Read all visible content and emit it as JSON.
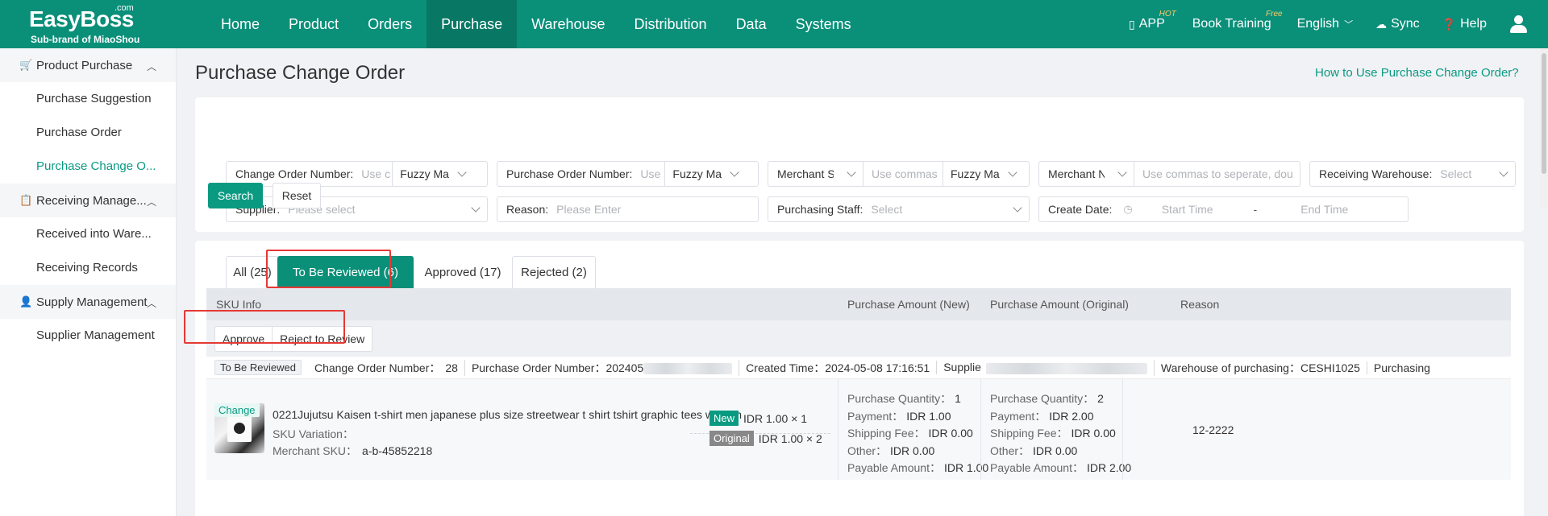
{
  "brand": {
    "name": "EasyBoss",
    "suffix": ".com",
    "sub": "Sub-brand of MiaoShou"
  },
  "nav": [
    "Home",
    "Product",
    "Orders",
    "Purchase",
    "Warehouse",
    "Distribution",
    "Data",
    "Systems"
  ],
  "nav_active": "Purchase",
  "top_right": {
    "app": "APP",
    "app_badge": "HOT",
    "training": "Book Training",
    "training_badge": "Free",
    "language": "English",
    "sync": "Sync",
    "help": "Help"
  },
  "sidebar": {
    "groups": [
      {
        "label": "Product Purchase",
        "items": [
          "Purchase Suggestion",
          "Purchase Order",
          "Purchase Change O..."
        ]
      },
      {
        "label": "Receiving Manage...",
        "items": [
          "Received into Ware...",
          "Receiving Records"
        ]
      },
      {
        "label": "Supply Management",
        "items": [
          "Supplier Management"
        ]
      }
    ]
  },
  "page": {
    "title": "Purchase Change Order",
    "help_link": "How to Use Purchase Change Order?"
  },
  "filters": {
    "change_order_number": {
      "label": "Change Order Number:",
      "placeholder": "Use c",
      "mode": "Fuzzy Ma"
    },
    "purchase_order_number": {
      "label": "Purchase Order Number:",
      "placeholder": "Use",
      "mode": "Fuzzy Ma"
    },
    "merchant_s": {
      "label": "Merchant S",
      "placeholder": "Use commas",
      "mode": "Fuzzy Ma"
    },
    "merchant_n": {
      "label": "Merchant N",
      "placeholder": "Use commas to seperate, dou"
    },
    "receiving_warehouse": {
      "label": "Receiving Warehouse:",
      "placeholder": "Select"
    },
    "supplier": {
      "label": "Supplier:",
      "placeholder": "Please select"
    },
    "reason": {
      "label": "Reason:",
      "placeholder": "Please Enter"
    },
    "purchasing_staff": {
      "label": "Purchasing Staff:",
      "placeholder": "Select"
    },
    "create_date": {
      "label": "Create Date:",
      "start": "Start Time",
      "sep": "-",
      "end": "End Time"
    },
    "search": "Search",
    "reset": "Reset"
  },
  "tabs": [
    "All (25)",
    "To Be Reviewed (6)",
    "Approved (17)",
    "Rejected (2)"
  ],
  "tab_active": "To Be Reviewed (6)",
  "table": {
    "headers": [
      "SKU Info",
      "Purchase Amount (New)",
      "Purchase Amount (Original)",
      "Reason"
    ],
    "bulk": [
      "Approve",
      "Reject to Review"
    ]
  },
  "order": {
    "status": "To Be Reviewed",
    "change_order_label": "Change Order Number：",
    "change_order_value": "28",
    "po_label": "Purchase Order Number：",
    "po_value": "202405",
    "created_label": "Created Time：",
    "created_value": "2024-05-08 17:16:51",
    "supplier_label": "Supplie",
    "warehouse_label": "Warehouse of purchasing：",
    "warehouse_value": "CESHI1025",
    "purchasing": "Purchasing",
    "item": {
      "change_tag": "Change",
      "name": "0221Jujutsu Kaisen t-shirt men japanese plus size streetwear t shirt tshirt graphic tees women",
      "variation_label": "SKU Variation：",
      "sku_label": "Merchant SKU：",
      "sku_value": "a-b-45852218",
      "new_tag": "New",
      "new_price": "IDR 1.00 × 1",
      "orig_tag": "Original",
      "orig_price": "IDR 1.00 × 2"
    },
    "new_amount": {
      "qty_label": "Purchase Quantity：",
      "qty": "1",
      "pay_label": "Payment：",
      "pay": "IDR 1.00",
      "ship_label": "Shipping Fee：",
      "ship": "IDR 0.00",
      "other_label": "Other：",
      "other": "IDR 0.00",
      "payable_label": "Payable Amount：",
      "payable": "IDR 1.00"
    },
    "orig_amount": {
      "qty_label": "Purchase Quantity：",
      "qty": "2",
      "pay_label": "Payment：",
      "pay": "IDR 2.00",
      "ship_label": "Shipping Fee：",
      "ship": "IDR 0.00",
      "other_label": "Other：",
      "other": "IDR 0.00",
      "payable_label": "Payable Amount：",
      "payable": "IDR 2.00"
    },
    "reason": "12-2222"
  },
  "colors": {
    "brand": "#0a8f79",
    "accent": "#0a9a82",
    "highlight": "#e53935"
  }
}
